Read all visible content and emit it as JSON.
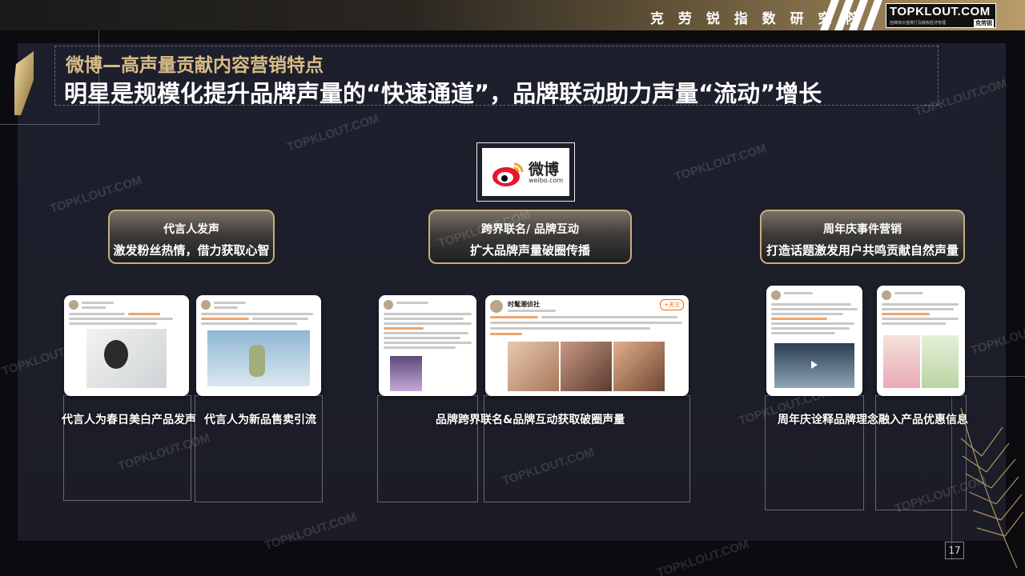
{
  "header": {
    "brand_title": "克 劳 锐 指 数 研 究 院",
    "logo_text": "TOPKLOUT.COM",
    "logo_sub": "自媒体价值排行及版权经济管理",
    "logo_badge": "克劳锐"
  },
  "slide": {
    "subtitle": "微博—高声量贡献内容营销特点",
    "title": "明星是规模化提升品牌声量的“快速通道”，品牌联动助力声量“流动”增长",
    "page_number": "17"
  },
  "weibo": {
    "name": "微博",
    "url": "weibo.com"
  },
  "pills": [
    {
      "line1": "代言人发声",
      "line2": "激发粉丝热情，借力获取心智"
    },
    {
      "line1": "跨界联名/ 品牌互动",
      "line2": "扩大品牌声量破圈传播"
    },
    {
      "line1": "周年庆事件营销",
      "line2": "打造话题激发用户共鸣贡献自然声量"
    }
  ],
  "captions": [
    "代言人为春日美白产品发声",
    "代言人为新品售卖引流",
    "品牌跨界联名&品牌互动获取破圈声量",
    "周年庆诠释品牌理念融入产品优惠信息"
  ],
  "post_snippets": {
    "post4_user": "时髦潮侦社",
    "post4_follow": "+关注"
  },
  "watermark": "TOPKLOUT.COM",
  "colors": {
    "gold": "#c9ad7a",
    "title_gold": "#d9bd86",
    "panel": "#1d1f2c"
  }
}
